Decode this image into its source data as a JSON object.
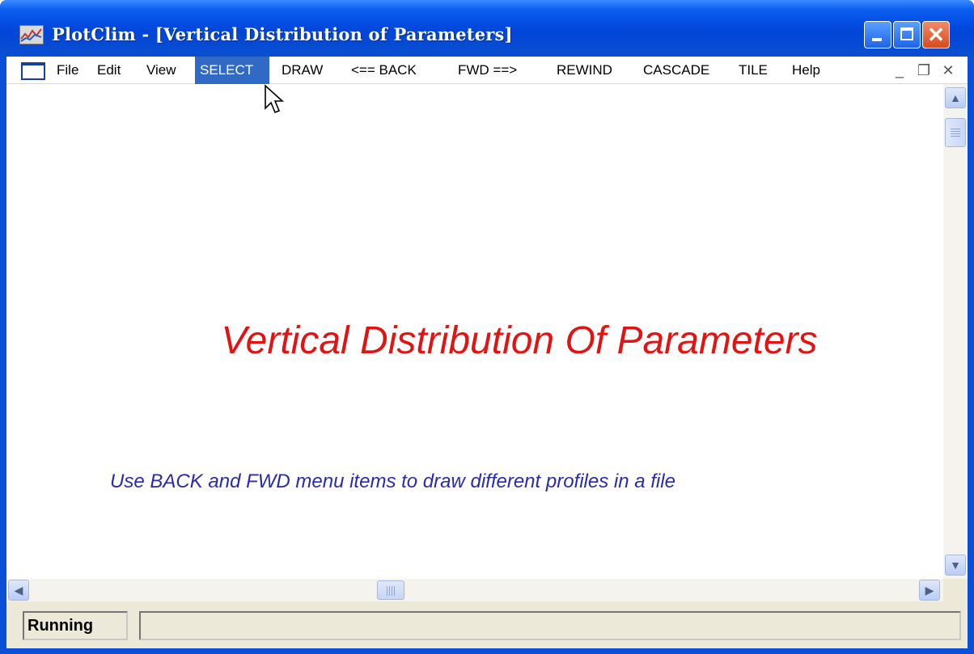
{
  "window": {
    "title": "PlotClim - [Vertical Distribution of Parameters]",
    "icon": "chart-icon",
    "controls": [
      "minimize-icon",
      "maximize-icon",
      "close-icon"
    ]
  },
  "menu": {
    "items": [
      {
        "label": "File"
      },
      {
        "label": "Edit"
      },
      {
        "label": "View"
      },
      {
        "label": "SELECT",
        "active": true
      },
      {
        "label": "DRAW"
      },
      {
        "label": "<== BACK"
      },
      {
        "label": "FWD ==>"
      },
      {
        "label": "REWIND"
      },
      {
        "label": "CASCADE"
      },
      {
        "label": "TILE"
      },
      {
        "label": "Help"
      }
    ],
    "mdi_controls": {
      "minimize": "_",
      "restore": "❐",
      "close": "✕"
    }
  },
  "content": {
    "heading": "Vertical Distribution Of Parameters",
    "hint": "Use BACK and FWD menu items to draw different profiles in a file"
  },
  "status": {
    "left": "Running",
    "right": ""
  },
  "colors": {
    "heading": "#e11414",
    "hint": "#2a2ab0",
    "titlebar": "#0045d8",
    "menu_active": "#316ac5"
  }
}
